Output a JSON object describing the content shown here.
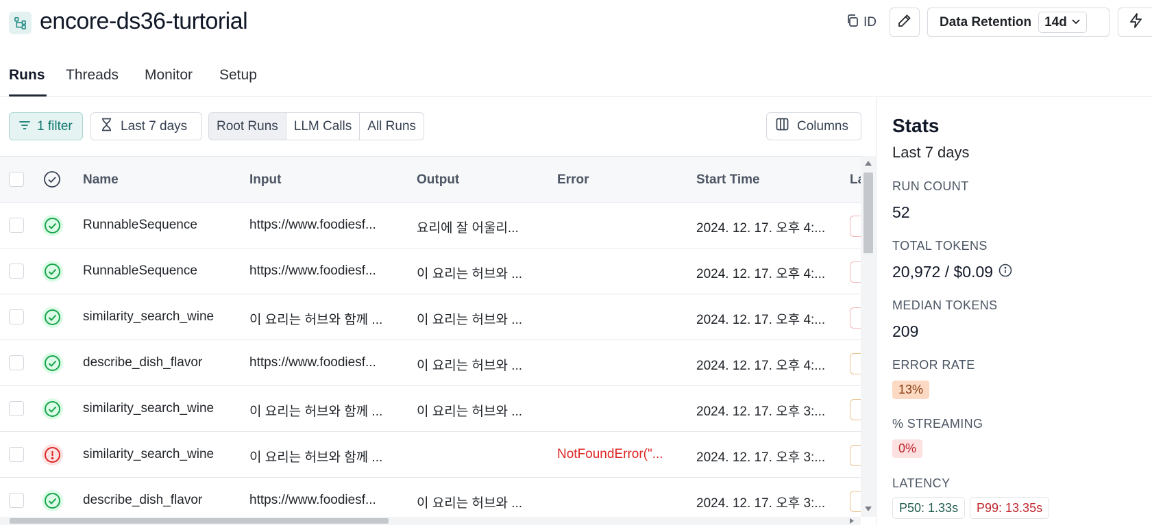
{
  "project": {
    "title": "encore-ds36-turtorial"
  },
  "header": {
    "id_label": "ID",
    "retention_label": "Data Retention",
    "retention_value": "14d"
  },
  "tabs": [
    {
      "label": "Runs",
      "active": true
    },
    {
      "label": "Threads",
      "active": false
    },
    {
      "label": "Monitor",
      "active": false
    },
    {
      "label": "Setup",
      "active": false
    }
  ],
  "toolbar": {
    "filter_label": "1 filter",
    "date_label": "Last 7 days",
    "run_types": [
      "Root Runs",
      "LLM Calls",
      "All Runs"
    ],
    "active_run_type": "Root Runs",
    "columns_label": "Columns"
  },
  "table": {
    "headers": {
      "name": "Name",
      "input": "Input",
      "output": "Output",
      "error": "Error",
      "start_time": "Start Time",
      "latency_partial": "La"
    },
    "rows": [
      {
        "status": "success",
        "name": "RunnableSequence",
        "input": "https://www.foodiesf...",
        "output": "요리에 잘 어울리...",
        "error": "",
        "start_time": "2024. 12. 17. 오후 4:..."
      },
      {
        "status": "success",
        "name": "RunnableSequence",
        "input": "https://www.foodiesf...",
        "output": "이 요리는 허브와 ...",
        "error": "",
        "start_time": "2024. 12. 17. 오후 4:..."
      },
      {
        "status": "success",
        "name": "similarity_search_wine",
        "input": "이 요리는 허브와 함께 ...",
        "output": "이 요리는 허브와 ...",
        "error": "",
        "start_time": "2024. 12. 17. 오후 4:..."
      },
      {
        "status": "success",
        "name": "describe_dish_flavor",
        "input": "https://www.foodiesf...",
        "output": "이 요리는 허브와 ...",
        "error": "",
        "start_time": "2024. 12. 17. 오후 4:..."
      },
      {
        "status": "success",
        "name": "similarity_search_wine",
        "input": "이 요리는 허브와 함께 ...",
        "output": "이 요리는 허브와 ...",
        "error": "",
        "start_time": "2024. 12. 17. 오후 3:..."
      },
      {
        "status": "error",
        "name": "similarity_search_wine",
        "input": "이 요리는 허브와 함께 ...",
        "output": "",
        "error": "NotFoundError(\"...",
        "start_time": "2024. 12. 17. 오후 3:..."
      },
      {
        "status": "success",
        "name": "describe_dish_flavor",
        "input": "https://www.foodiesf...",
        "output": "이 요리는 허브와 ...",
        "error": "",
        "start_time": "2024. 12. 17. 오후 3:..."
      }
    ]
  },
  "stats": {
    "title": "Stats",
    "subtitle": "Last 7 days",
    "run_count_label": "RUN COUNT",
    "run_count": "52",
    "total_tokens_label": "TOTAL TOKENS",
    "total_tokens": "20,972 / $0.09",
    "median_tokens_label": "MEDIAN TOKENS",
    "median_tokens": "209",
    "error_rate_label": "ERROR RATE",
    "error_rate": "13%",
    "streaming_label": "% STREAMING",
    "streaming": "0%",
    "latency_label": "LATENCY",
    "p50": "P50: 1.33s",
    "p99": "P99: 13.35s"
  },
  "colors": {
    "accent": "#0f766e",
    "success": "#16a34a",
    "error": "#dc2626"
  }
}
